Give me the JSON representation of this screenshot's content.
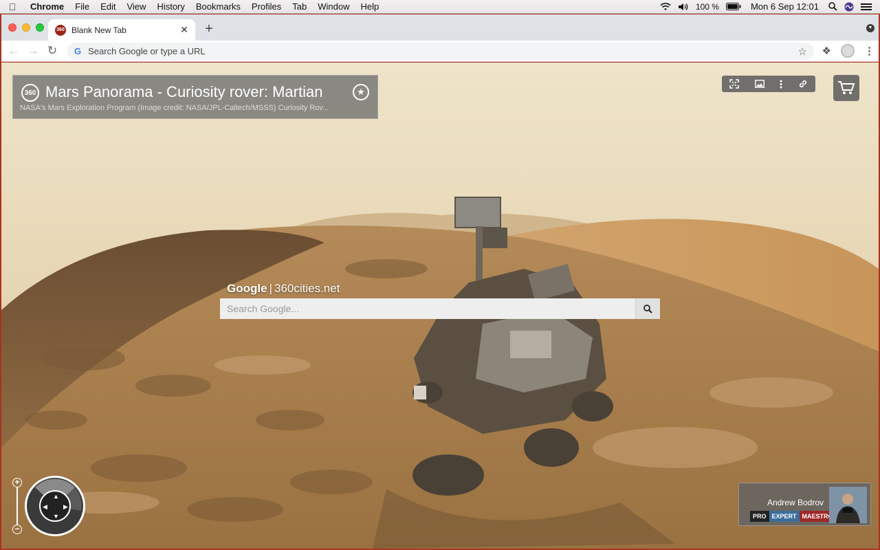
{
  "menubar": {
    "app": "Chrome",
    "items": [
      "File",
      "Edit",
      "View",
      "History",
      "Bookmarks",
      "Profiles",
      "Tab",
      "Window",
      "Help"
    ],
    "battery": "100 %",
    "clock": "Mon 6 Sep  12:01"
  },
  "browser": {
    "tab_title": "Blank New Tab",
    "tab_favicon": "360",
    "omnibox_placeholder": "Search Google or type a URL"
  },
  "panorama": {
    "badge": "360",
    "title": "Mars Panorama - Curiosity rover: Martian s...",
    "subtitle": "NASA's Mars Exploration Program (Image credit: NASA/JPL-Caltech/MSSS)   Curiosity Rov...",
    "search_brand": "Google",
    "search_sep": "|",
    "search_site": "360cities.net",
    "search_placeholder": "Search Google..."
  },
  "author": {
    "name": "Andrew Bodrov",
    "badges": [
      "PRO",
      "EXPERT",
      "MAESTRO"
    ]
  },
  "colors": {
    "window_border": "#a9331f",
    "favicon": "#9b2317",
    "badge_expert": "#3c6e9b",
    "badge_maestro": "#a02828"
  },
  "icons": [
    "apple-icon",
    "wifi-icon",
    "volume-icon",
    "battery-icon",
    "spotlight-icon",
    "siri-icon",
    "control-center-icon",
    "back-icon",
    "forward-icon",
    "reload-icon",
    "google-icon",
    "bookmark-star-icon",
    "extensions-icon",
    "profile-icon",
    "kebab-menu-icon",
    "fullscreen-icon",
    "image-icon",
    "more-icon",
    "link-icon",
    "cart-icon",
    "search-icon",
    "zoom-in-icon",
    "zoom-out-icon"
  ]
}
